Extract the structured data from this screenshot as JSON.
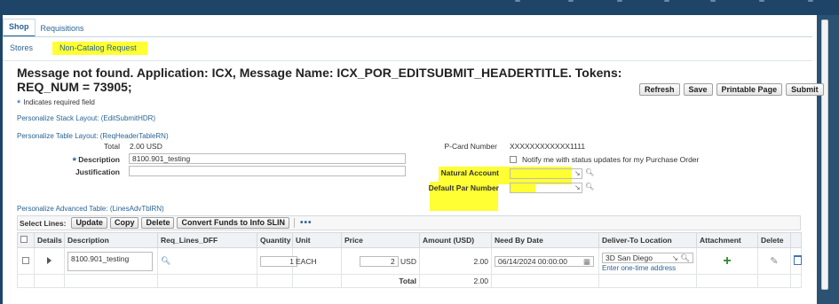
{
  "tabs": {
    "shop": "Shop",
    "requisitions": "Requisitions"
  },
  "subtabs": {
    "stores": "Stores",
    "non_catalog": "Non-Catalog Request"
  },
  "message": "Message not found. Application: ICX, Message Name: ICX_POR_EDITSUBMIT_HEADERTITLE. Tokens: REQ_NUM = 73905;",
  "actions": {
    "refresh": "Refresh",
    "save": "Save",
    "printable": "Printable Page",
    "submit": "Submit"
  },
  "required_note": "Indicates required field",
  "required_star": "*",
  "links": {
    "stack": "Personalize Stack Layout: (EditSubmitHDR)",
    "table": "Personalize Table Layout: (ReqHeaderTableRN)",
    "advanced": "Personalize Advanced Table: (LinesAdvTblRN)"
  },
  "header": {
    "total_label": "Total",
    "total_value": "2.00 USD",
    "description_label": "Description",
    "description_value": "8100.901_testing",
    "justification_label": "Justification",
    "justification_value": "",
    "pcard_label": "P-Card Number",
    "pcard_value": "XXXXXXXXXXXX1111",
    "notify_label": "Notify me with status updates for my Purchase Order",
    "natural_account_label": "Natural Account",
    "default_par_label": "Default Par Number"
  },
  "toolbar": {
    "select_label": "Select Lines:",
    "update": "Update",
    "copy": "Copy",
    "delete": "Delete",
    "convert": "Convert Funds to Info SLIN",
    "more": "•••"
  },
  "grid": {
    "columns": [
      "Details",
      "Description",
      "Req_Lines_DFF",
      "Quantity",
      "Unit",
      "Price",
      "Amount (USD)",
      "Need By Date",
      "Deliver-To Location",
      "Attachment",
      "Delete"
    ],
    "row": {
      "description": "8100.901_testing",
      "quantity": "1",
      "unit": "EACH",
      "price": "2",
      "currency": "USD",
      "amount": "2.00",
      "need_by": "06/14/2024 00:00:00",
      "location": "3D San Diego",
      "enter_address": "Enter one-time address"
    },
    "total_label": "Total",
    "total_value": "2.00"
  },
  "colors": {
    "highlight": "#ffff33",
    "link": "#2a6496",
    "frame": "#1e4568"
  }
}
